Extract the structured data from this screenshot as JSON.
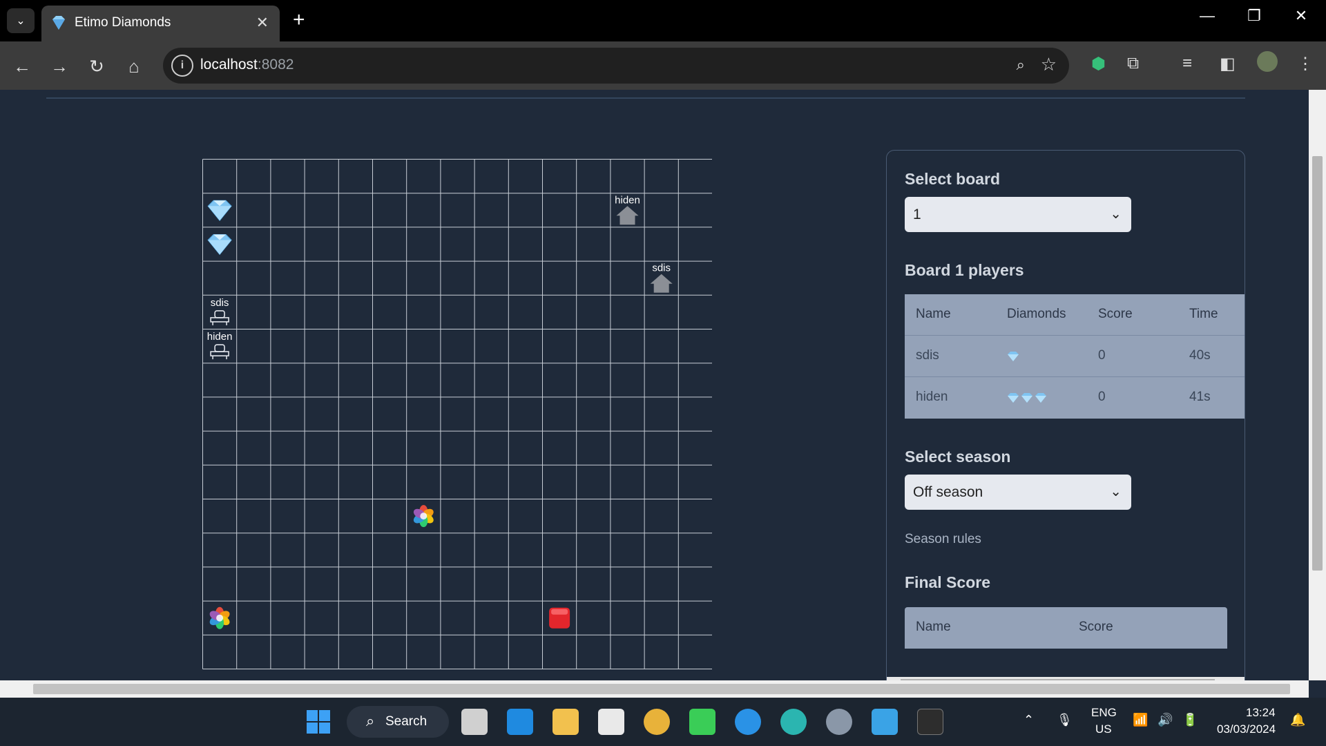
{
  "browser": {
    "tab_title": "Etimo Diamonds",
    "url_host": "localhost",
    "url_port": ":8082"
  },
  "board": {
    "cols": 15,
    "rows": 15,
    "diamonds": [
      {
        "col": 0,
        "row": 1,
        "points": 1
      },
      {
        "col": 0,
        "row": 2,
        "points": 1
      }
    ],
    "bases": [
      {
        "col": 12,
        "row": 1,
        "name": "hiden"
      },
      {
        "col": 13,
        "row": 3,
        "name": "sdis"
      }
    ],
    "bots": [
      {
        "col": 0,
        "row": 4,
        "name": "sdis"
      },
      {
        "col": 0,
        "row": 5,
        "name": "hiden"
      }
    ],
    "teleporters": [
      {
        "col": 6,
        "row": 10
      },
      {
        "col": 0,
        "row": 13
      }
    ],
    "red_buttons": [
      {
        "col": 10,
        "row": 13
      }
    ]
  },
  "panel": {
    "select_board_label": "Select board",
    "board_value": "1",
    "players_heading": "Board 1 players",
    "columns": [
      "Name",
      "Diamonds",
      "Score",
      "Time"
    ],
    "players": [
      {
        "name": "sdis",
        "diamonds": 1,
        "score": "0",
        "time": "40s"
      },
      {
        "name": "hiden",
        "diamonds": 3,
        "score": "0",
        "time": "41s"
      }
    ],
    "select_season_label": "Select season",
    "season_value": "Off season",
    "season_rules": "Season rules",
    "final_score_heading": "Final Score",
    "final_columns": [
      "Name",
      "Score"
    ]
  },
  "taskbar": {
    "search_label": "Search",
    "lang": "ENG",
    "region": "US",
    "time": "13:24",
    "date": "03/03/2024"
  },
  "colors": {
    "page_bg": "#1f2a3a",
    "grid_line": "#c8ced6",
    "table_bg": "#94a2b8",
    "diamond": "#7fc4f2"
  }
}
